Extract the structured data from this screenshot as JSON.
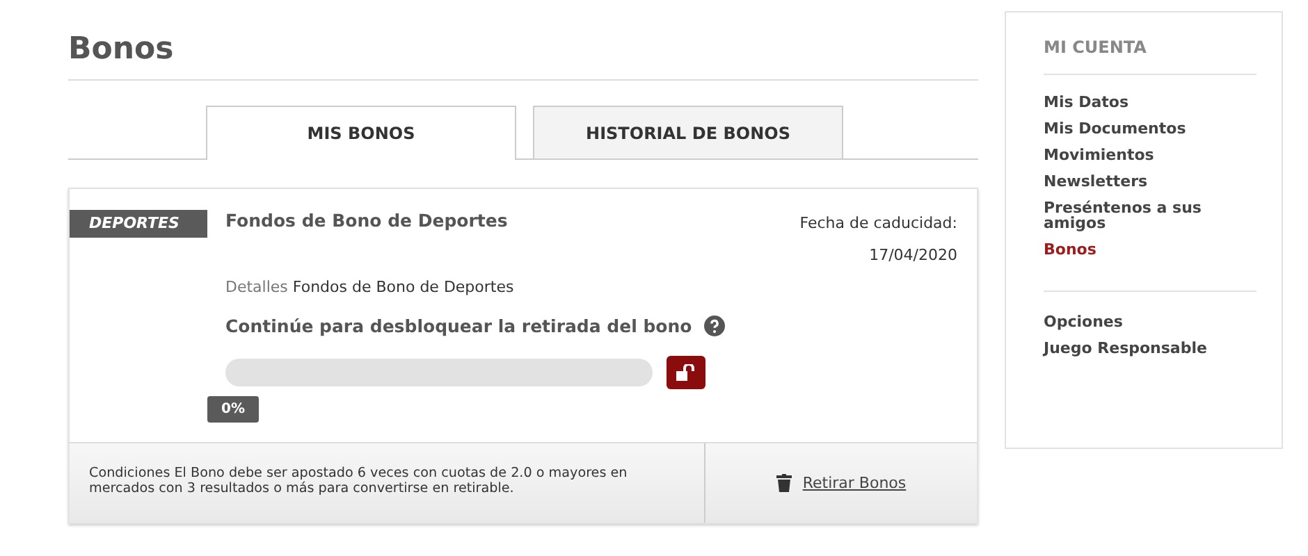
{
  "page_title": "Bonos",
  "tabs": [
    {
      "label": "MIS BONOS",
      "selected": true
    },
    {
      "label": "HISTORIAL DE BONOS",
      "selected": false
    }
  ],
  "bonus": {
    "category": "DEPORTES",
    "name": "Fondos de Bono de Deportes",
    "expiry_label": "Fecha de caducidad:",
    "expiry_date": "17/04/2020",
    "details_label": "Detalles",
    "details_value": "Fondos de Bono de Deportes",
    "progress_title": "Continúe para desbloquear la retirada del bono",
    "progress_reading": "0%",
    "conditions": "Condiciones El Bono debe ser apostado 6 veces con cuotas de 2.0 o mayores en mercados con 3 resultados o más para convertirse en retirable.",
    "withdraw_label": "Retirar Bonos"
  },
  "sidebar": {
    "title": "MI CUENTA",
    "groups": [
      [
        {
          "label": "Mis Datos",
          "selected": false
        },
        {
          "label": "Mis Documentos",
          "selected": false
        },
        {
          "label": "Movimientos",
          "selected": false
        },
        {
          "label": "Newsletters",
          "selected": false
        },
        {
          "label": "Preséntenos a sus amigos",
          "selected": false
        },
        {
          "label": "Bonos",
          "selected": true
        }
      ],
      [
        {
          "label": "Opciones",
          "selected": false
        },
        {
          "label": "Juego Responsable",
          "selected": false
        }
      ]
    ]
  }
}
